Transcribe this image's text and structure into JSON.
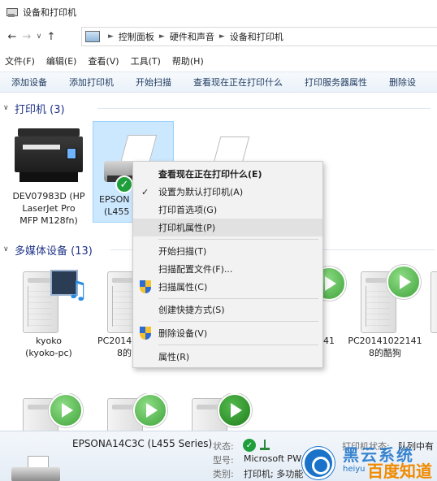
{
  "window": {
    "title": "设备和打印机"
  },
  "nav": {
    "back_icon": "back-arrow-icon",
    "forward_icon": "forward-arrow-icon",
    "up_icon": "up-arrow-icon",
    "breadcrumb": [
      "控制面板",
      "硬件和声音",
      "设备和打印机"
    ]
  },
  "menu": [
    "文件(F)",
    "编辑(E)",
    "查看(V)",
    "工具(T)",
    "帮助(H)"
  ],
  "commands": [
    "添加设备",
    "添加打印机",
    "开始扫描",
    "查看现在正在打印什么",
    "打印服务器属性",
    "删除设"
  ],
  "groups": {
    "printers": {
      "label": "打印机 (3)"
    },
    "media": {
      "label": "多媒体设备 (13)"
    }
  },
  "printers": [
    {
      "label_lines": [
        "DEV07983D (HP",
        "LaserJet Pro",
        "MFP M128fn)"
      ]
    },
    {
      "label_lines": [
        "EPSON",
        "(L455"
      ]
    }
  ],
  "media_devices": [
    {
      "label_lines": [
        "kyoko",
        "(kyoko-pc)"
      ]
    },
    {
      "label_lines": [
        "PC2014",
        "8的"
      ]
    },
    {
      "label_lines": [
        "41"
      ]
    },
    {
      "label_lines": [
        "PC20141022141",
        "8的酷狗"
      ]
    }
  ],
  "context_menu": {
    "items": [
      {
        "label": "查看现在正在打印什么(E)",
        "bold": true
      },
      {
        "label": "设置为默认打印机(A)",
        "checked": true
      },
      {
        "label": "打印首选项(G)"
      },
      {
        "label": "打印机属性(P)",
        "hover": true
      },
      {
        "label": "开始扫描(T)"
      },
      {
        "label": "扫描配置文件(F)..."
      },
      {
        "label": "扫描属性(C)",
        "shield": true
      },
      {
        "label": "创建快捷方式(S)"
      },
      {
        "label": "删除设备(V)",
        "shield": true
      },
      {
        "label": "属性(R)"
      }
    ]
  },
  "details": {
    "name": "EPSONA14C3C (L455 Series)",
    "status_key": "状态:",
    "model_key": "型号:",
    "model_value": "Microsoft PW",
    "category_key": "类别:",
    "category_value": "打印机; 多功能",
    "printer_status_key": "打印机状态:",
    "printer_status_value": "队列中有"
  },
  "watermark": {
    "line1": "黑云系统",
    "line2": "heiyu",
    "line3": "百度知道"
  }
}
